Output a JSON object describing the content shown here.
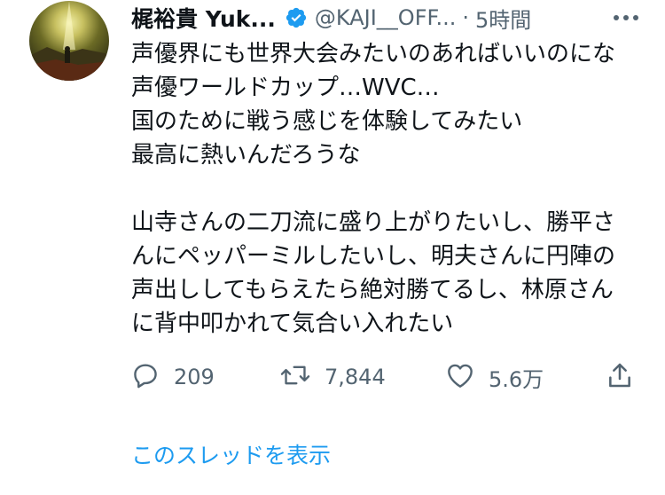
{
  "author": {
    "display_name": "梶裕貴 Yuk...",
    "handle": "@KAJI__OFF...",
    "separator": "·",
    "time": "5時間",
    "verified": true
  },
  "icons": {
    "verified": "verified-badge-icon",
    "more": "more-icon",
    "reply": "reply-icon",
    "retweet": "retweet-icon",
    "like": "like-icon",
    "share": "share-icon"
  },
  "tweet": {
    "lines": [
      "声優界にも世界大会みたいのあればいいのにな",
      "声優ワールドカップ…WVC…",
      "国のために戦う感じを体験してみたい",
      "最高に熱いんだろうな",
      "",
      "山寺さんの二刀流に盛り上がりたいし、勝平さ",
      "んにペッパーミルしたいし、明夫さんに円陣の",
      "声出ししてもらえたら絶対勝てるし、林原さん",
      "に背中叩かれて気合い入れたい"
    ]
  },
  "actions": {
    "reply_count": "209",
    "retweet_count": "7,844",
    "like_count": "5.6万"
  },
  "thread_link": "このスレッドを表示",
  "colors": {
    "text": "#0f1419",
    "secondary": "#536471",
    "accent": "#1d9bf0"
  }
}
